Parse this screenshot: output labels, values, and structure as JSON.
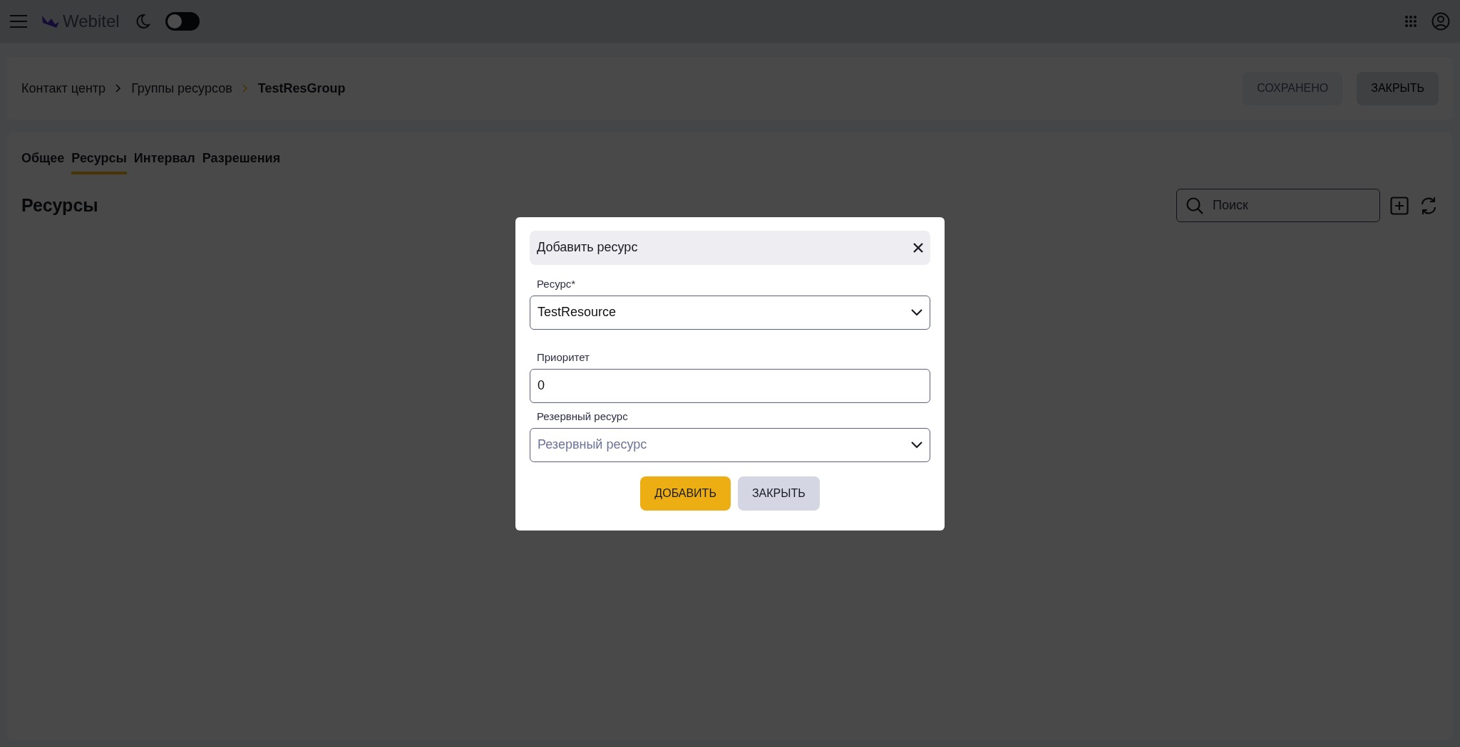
{
  "top_bar": {
    "logo_text": "Webitel",
    "dark_mode": {
      "on": false
    }
  },
  "header": {
    "breadcrumbs": [
      "Контакт центр",
      "Группы ресурсов",
      "TestResGroup"
    ],
    "buttons": [
      {
        "label": "СОХРАНЕНО",
        "disabled": true
      },
      {
        "label": "ЗАКРЫТЬ",
        "disabled": false
      }
    ]
  },
  "tabs": [
    {
      "label": "Общее",
      "selected": false
    },
    {
      "label": "Ресурсы",
      "selected": true
    },
    {
      "label": "Интервал",
      "selected": false
    },
    {
      "label": "Разрешения",
      "selected": false
    }
  ],
  "section": {
    "title": "Ресурсы",
    "search": {
      "placeholder": "Поиск"
    }
  },
  "dialog": {
    "title": "Добавить ресурс",
    "fields": [
      {
        "kind": "select",
        "label": "Ресурс*",
        "value": "TestResource"
      },
      {
        "kind": "input",
        "label": "Приоритет",
        "value": "0"
      },
      {
        "kind": "select",
        "label": "Резервный ресурс",
        "placeholder": "Резервный ресурс"
      }
    ],
    "buttons": [
      {
        "label": "ДОБАВИТЬ",
        "primary": true
      },
      {
        "label": "ЗАКРЫТЬ",
        "primary": false
      }
    ]
  }
}
